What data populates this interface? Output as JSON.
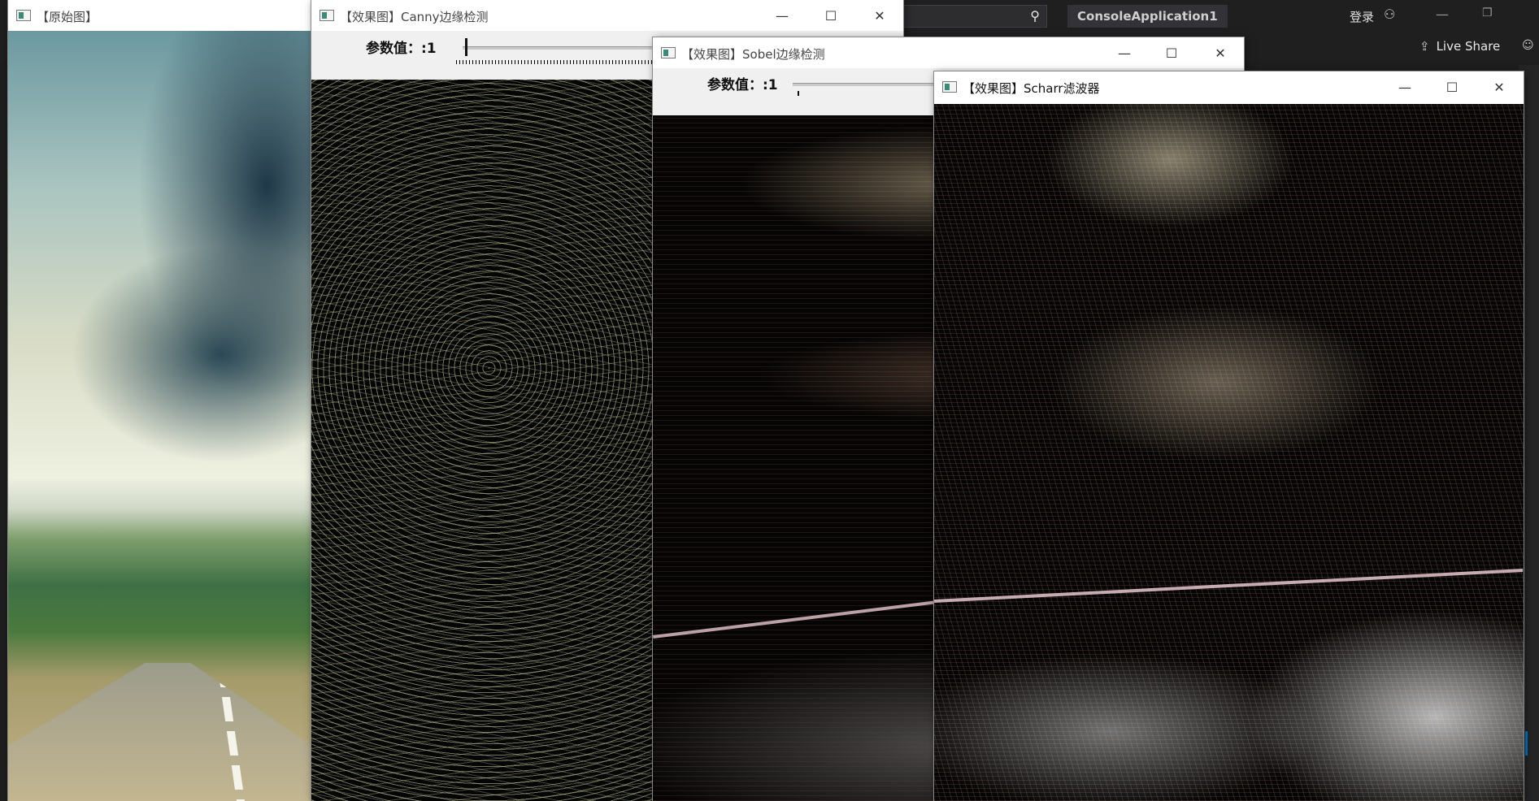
{
  "vs": {
    "search_icon": "search-icon",
    "project_name": "ConsoleApplication1",
    "login_label": "登录",
    "live_share_label": "Live Share",
    "accent_color": "#007acc"
  },
  "windows": {
    "original": {
      "title": "【原始图】"
    },
    "canny": {
      "title": "【效果图】Canny边缘检测",
      "trackbar_label": "参数值：:1",
      "trackbar_value": 1
    },
    "sobel": {
      "title": "【效果图】Sobel边缘检测",
      "trackbar_label": "参数值：:1",
      "trackbar_value": 1
    },
    "scharr": {
      "title": "【效果图】Scharr滤波器"
    }
  },
  "controls": {
    "minimize": "—",
    "maximize": "☐",
    "close": "✕"
  }
}
